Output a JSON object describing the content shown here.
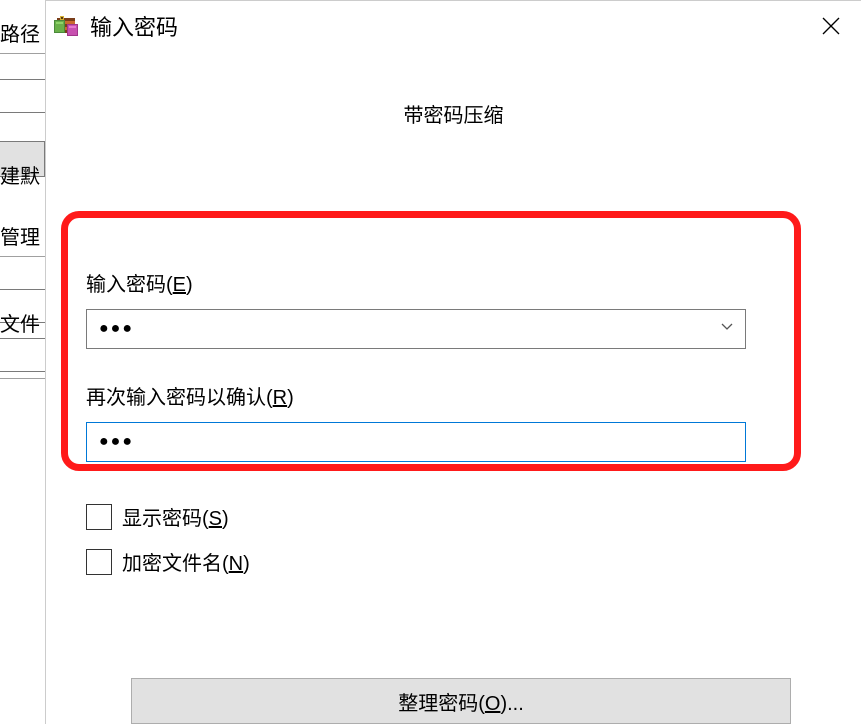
{
  "background": {
    "label1": "路径",
    "label2": "建默",
    "label3": "管理",
    "label4": "文件"
  },
  "dialog": {
    "title": "输入密码",
    "header": "带密码压缩",
    "password_label_prefix": "输入密码(",
    "password_label_key": "E",
    "password_label_suffix": ")",
    "password_value": "●●●",
    "confirm_label_prefix": "再次输入密码以确认(",
    "confirm_label_key": "R",
    "confirm_label_suffix": ")",
    "confirm_value": "●●●",
    "show_password_prefix": "显示密码(",
    "show_password_key": "S",
    "show_password_suffix": ")",
    "encrypt_names_prefix": "加密文件名(",
    "encrypt_names_key": "N",
    "encrypt_names_suffix": ")",
    "manage_prefix": "整理密码(",
    "manage_key": "O",
    "manage_suffix": ")..."
  }
}
